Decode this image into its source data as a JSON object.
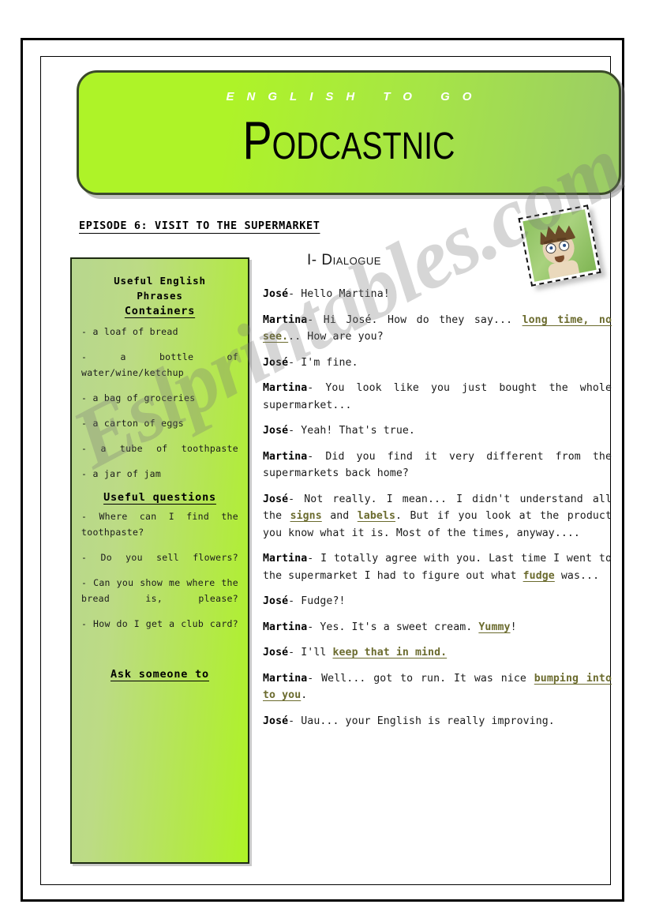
{
  "banner": {
    "subtitle": "ENGLISH TO GO",
    "title": "Podcastnic"
  },
  "episode_title": "EPISODE 6: VISIT TO THE SUPERMARKET",
  "dialogue_heading": "I- Dialogue",
  "watermark": "Eslprintables.com",
  "photo": {
    "alt": "cartoon boy portrait"
  },
  "sidebar": {
    "heading_line1": "Useful English",
    "heading_line2": "Phrases",
    "containers_heading": "Containers",
    "containers": [
      "- a loaf of bread",
      "- a bottle of water/wine/ketchup",
      "- a bag of groceries",
      "- a carton of eggs",
      "- a tube of toothpaste",
      "- a jar of jam"
    ],
    "questions_heading": "Useful questions",
    "questions": [
      "- Where can I find the toothpaste?",
      "- Do you sell flowers?",
      "- Can you show me where the bread is, please?",
      "- How do I get a club card?"
    ],
    "ask_heading": "Ask someone to"
  },
  "dialogue": [
    {
      "speaker": "José",
      "parts": [
        {
          "text": "- Hello Martina!",
          "style": "plain"
        }
      ]
    },
    {
      "speaker": "Martina",
      "parts": [
        {
          "text": "- Hi José. How do they say... ",
          "style": "plain"
        },
        {
          "text": "long time, no see.",
          "style": "highlight"
        },
        {
          "text": ".. How are you?",
          "style": "plain"
        }
      ]
    },
    {
      "speaker": "José",
      "parts": [
        {
          "text": "-  I'm fine.",
          "style": "plain"
        }
      ]
    },
    {
      "speaker": "Martina",
      "parts": [
        {
          "text": "- You look like you just bought the whole supermarket...",
          "style": "plain"
        }
      ]
    },
    {
      "speaker": "José",
      "parts": [
        {
          "text": "-  Yeah! That's true.",
          "style": "plain"
        }
      ]
    },
    {
      "speaker": "Martina",
      "parts": [
        {
          "text": "- Did you find it very different from the supermarkets back home?",
          "style": "plain"
        }
      ]
    },
    {
      "speaker": "José",
      "parts": [
        {
          "text": "- Not really. I mean... I didn't understand all the ",
          "style": "plain"
        },
        {
          "text": "signs",
          "style": "highlight"
        },
        {
          "text": " and ",
          "style": "plain"
        },
        {
          "text": "labels",
          "style": "highlight"
        },
        {
          "text": ". But if you look at the product you know what it is. Most of the times, anyway....",
          "style": "plain"
        }
      ]
    },
    {
      "speaker": "Martina",
      "parts": [
        {
          "text": "- I totally agree with you. Last time I went to the supermarket I had to figure out what ",
          "style": "plain"
        },
        {
          "text": "fudge",
          "style": "highlight"
        },
        {
          "text": " was...",
          "style": "plain"
        }
      ]
    },
    {
      "speaker": "José",
      "parts": [
        {
          "text": "-  Fudge?!",
          "style": "plain"
        }
      ]
    },
    {
      "speaker": "Martina",
      "parts": [
        {
          "text": "- Yes. It's a sweet cream. ",
          "style": "plain"
        },
        {
          "text": "Yummy",
          "style": "highlight"
        },
        {
          "text": "!",
          "style": "plain"
        }
      ]
    },
    {
      "speaker": "José",
      "parts": [
        {
          "text": "- I'll ",
          "style": "plain"
        },
        {
          "text": "keep that in mind.",
          "style": "highlight"
        }
      ]
    },
    {
      "speaker": "Martina",
      "parts": [
        {
          "text": "- Well... got to run. It was nice ",
          "style": "plain"
        },
        {
          "text": "bumping into to you",
          "style": "highlight"
        },
        {
          "text": ".",
          "style": "plain"
        }
      ]
    },
    {
      "speaker": "José",
      "parts": [
        {
          "text": "- Uau... your English is really improving.",
          "style": "plain"
        }
      ]
    }
  ],
  "colors": {
    "banner_light": "#aef328",
    "banner_dark": "#9bcb68",
    "sidebar_light": "#aef326",
    "sidebar_dark": "#b7d68e",
    "highlight": "#6b6b2e",
    "border": "#1d2b12"
  }
}
